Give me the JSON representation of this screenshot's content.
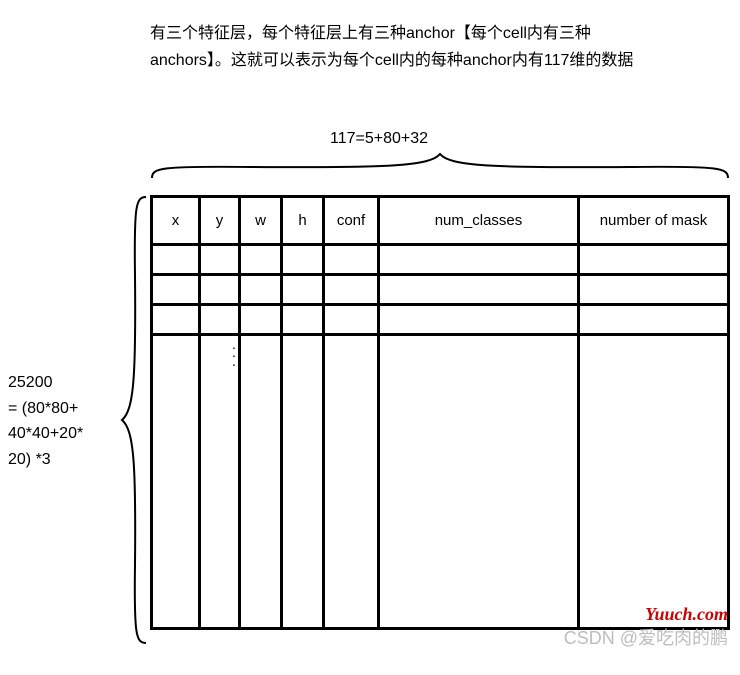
{
  "description": "有三个特征层，每个特征层上有三种anchor【每个cell内有三种anchors】。这就可以表示为每个cell内的每种anchor内有117维的数据",
  "top_equation": "117=5+80+32",
  "left_annotation": {
    "line1": "25200",
    "line2": "= (80*80+",
    "line3": "40*40+20*",
    "line4": "20) *3"
  },
  "headers": {
    "x": "x",
    "y": "y",
    "w": "w",
    "h": "h",
    "conf": "conf",
    "num_classes": "num_classes",
    "number_of_mask": "number of mask"
  },
  "watermark1": "Yuuch.com",
  "watermark2": "CSDN @爱吃肉的鹏",
  "chart_data": {
    "type": "table",
    "title": "Anchor output tensor layout",
    "columns": [
      "x",
      "y",
      "w",
      "h",
      "conf",
      "num_classes",
      "number of mask"
    ],
    "column_dim_note": "117 = 5 + 80 + 32",
    "row_dim_note": "25200 = (80*80 + 40*40 + 20*20) * 3",
    "rows_total": 25200,
    "cols_total": 117,
    "breakdown": {
      "bbox_conf": 5,
      "num_classes": 80,
      "number_of_mask": 32
    }
  }
}
